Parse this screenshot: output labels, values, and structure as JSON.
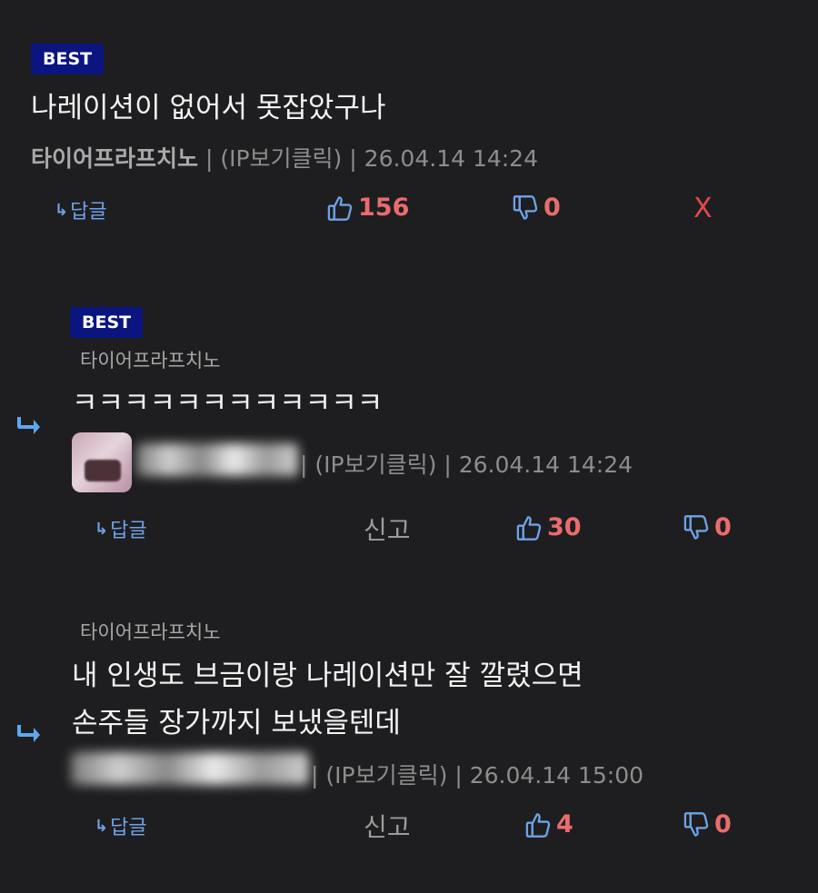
{
  "comments": [
    {
      "badge": "BEST",
      "text": "나레이션이 없어서 못잡았구나",
      "nick": "타이어프라프치노",
      "ip": "(IP보기클릭)",
      "sep": "|",
      "date": "26.04.14 14:24",
      "reply_label": "답글",
      "up": "156",
      "down": "0",
      "close": "X"
    },
    {
      "badge": "BEST",
      "reply_to": "타이어프라프치노",
      "text": "ㅋㅋㅋㅋㅋㅋㅋㅋㅋㅋㅋㅋ",
      "ip": "(IP보기클릭)",
      "sep": "|",
      "date": "26.04.14 14:24",
      "reply_label": "답글",
      "report": "신고",
      "up": "30",
      "down": "0"
    },
    {
      "reply_to": "타이어프라프치노",
      "text_line1": "내 인생도 브금이랑 나레이션만 잘 깔렸으면",
      "text_line2": "손주들 장가까지 보냈을텐데",
      "ip": "(IP보기클릭)",
      "sep": "|",
      "date": "26.04.14 15:00",
      "reply_label": "답글",
      "report": "신고",
      "up": "4",
      "down": "0"
    }
  ],
  "colors": {
    "background": "#1e1e20",
    "badge": "#0b1580",
    "accent_blue": "#6fa2e6",
    "vote_red": "#e86d6d",
    "close_red": "#e2494b"
  },
  "icons": [
    "reply-arrow-icon",
    "thumbs-up-icon",
    "thumbs-down-icon",
    "indent-arrow-icon"
  ]
}
